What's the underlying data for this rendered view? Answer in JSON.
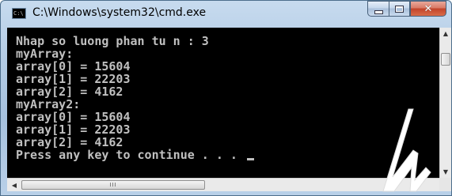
{
  "window": {
    "title": "C:\\Windows\\system32\\cmd.exe",
    "icon_text": "C:\\"
  },
  "console": {
    "lines": [
      "Nhap so luong phan tu n : 3",
      "myArray:",
      "array[0] = 15604",
      "array[1] = 22203",
      "array[2] = 4162",
      "myArray2:",
      "array[0] = 15604",
      "array[1] = 22203",
      "array[2] = 4162"
    ],
    "prompt": "Press any key to continue . . . "
  },
  "scrollbar": {
    "h_thumb_grip": "III"
  },
  "colors": {
    "console_bg": "#000000",
    "console_text": "#c0c0c0",
    "logo": "#ffffff"
  }
}
